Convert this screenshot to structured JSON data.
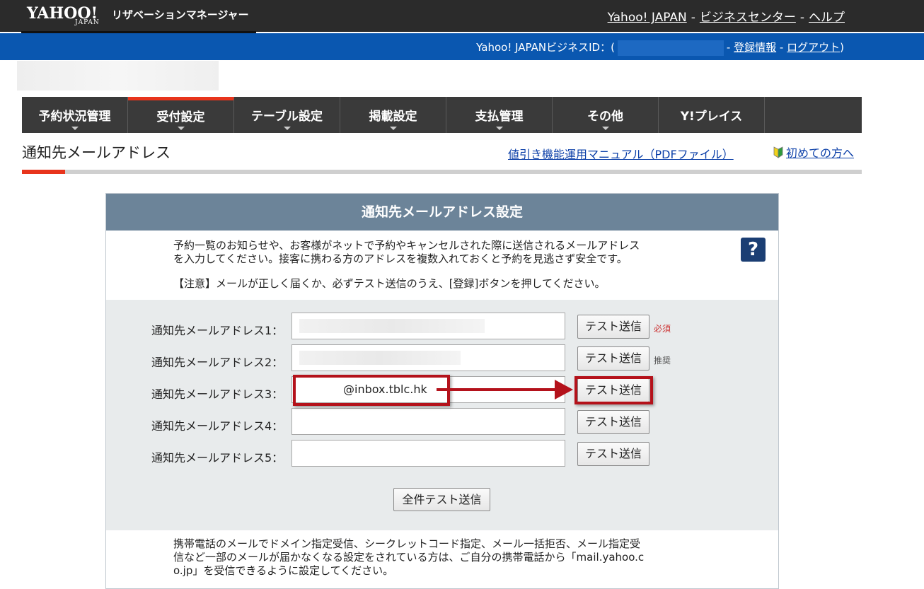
{
  "header": {
    "logo_text": "YAHOO!",
    "logo_sub": "JAPAN",
    "app_name": "リザベーションマネージャー",
    "links": [
      "Yahoo! JAPAN",
      "ビジネスセンター",
      "ヘルプ"
    ],
    "separator": "-"
  },
  "account_bar": {
    "business_id_label": "Yahoo! JAPANビジネスID：(",
    "closing_paren": ")",
    "register_info": "登録情報",
    "logout": "ログアウト",
    "separator": "-"
  },
  "nav": {
    "active_index": 1,
    "items": [
      {
        "label": "予約状況管理"
      },
      {
        "label": "受付設定"
      },
      {
        "label": "テーブル設定"
      },
      {
        "label": "掲載設定"
      },
      {
        "label": "支払管理"
      },
      {
        "label": "その他"
      },
      {
        "label": "Y!プレイス"
      }
    ]
  },
  "page": {
    "title": "通知先メールアドレス",
    "manual_link": "値引き機能運用マニュアル（PDFファイル）",
    "first_time_link": "初めての方へ"
  },
  "panel": {
    "heading": "通知先メールアドレス設定",
    "intro_line1": "予約一覧のお知らせや、お客様がネットで予約やキャンセルされた際に送信されるメールアドレス",
    "intro_line2": "を入力してください。接客に携わる方のアドレスを複数入れておくと予約を見逃さず安全です。",
    "notice": "【注意】メールが正しく届くか、必ずテスト送信のうえ、[登録]ボタンを押してください。",
    "help_icon_text": "?",
    "rows": [
      {
        "label": "通知先メールアドレス1：",
        "value": "",
        "button": "テスト送信",
        "tag": "必須"
      },
      {
        "label": "通知先メールアドレス2：",
        "value": "",
        "button": "テスト送信",
        "tag": "推奨"
      },
      {
        "label": "通知先メールアドレス3：",
        "value": "@inbox.tblc.hk",
        "button": "テスト送信",
        "tag": ""
      },
      {
        "label": "通知先メールアドレス4：",
        "value": "",
        "button": "テスト送信",
        "tag": ""
      },
      {
        "label": "通知先メールアドレス5：",
        "value": "",
        "button": "テスト送信",
        "tag": ""
      }
    ],
    "all_test_button": "全件テスト送信",
    "footer_line1": "携帯電話のメールでドメイン指定受信、シークレットコード指定、メール一括拒否、メール指定受",
    "footer_line2": "信など一部のメールが届かなくなる設定をされている方は、ご自分の携帯電話から「mail.yahoo.c",
    "footer_line3": "o.jp」を受信できるように設定してください。"
  },
  "colors": {
    "top_bar": "#2b2b2b",
    "account_bar": "#0a57b0",
    "nav_bg": "#3a3a3a",
    "nav_active_accent": "#e8341c",
    "panel_header": "#6c8499",
    "annotation_red": "#b4121b",
    "help_icon_bg": "#1b3e73"
  }
}
